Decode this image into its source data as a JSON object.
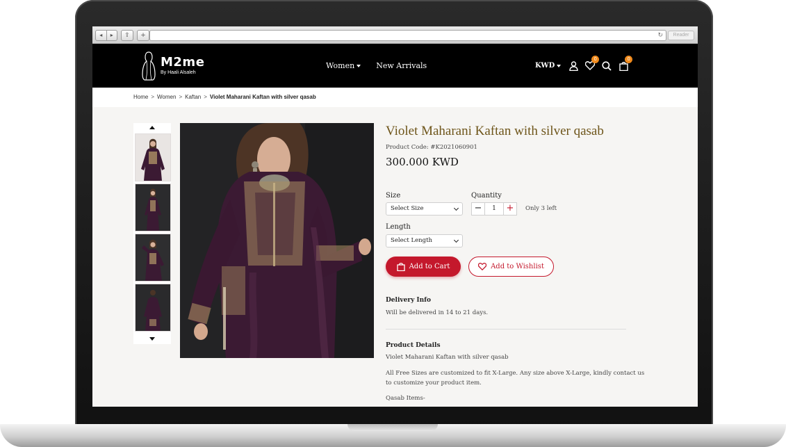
{
  "browser": {
    "reader_label": "Reader",
    "back_icon": "◂",
    "forward_icon": "▸",
    "share_icon": "⇪",
    "new_tab_icon": "+",
    "reload_icon": "↻"
  },
  "brand": {
    "name": "M2me",
    "tagline": "By Haali Alsaleh"
  },
  "nav": {
    "items": [
      {
        "label": "Women",
        "has_dropdown": true
      },
      {
        "label": "New Arrivals",
        "has_dropdown": false
      }
    ]
  },
  "header_tools": {
    "currency": "KWD",
    "wishlist_count": "0",
    "cart_count": "0"
  },
  "breadcrumb": {
    "items": [
      "Home",
      "Women",
      "Kaftan"
    ],
    "current": "Violet Maharani Kaftan with silver qasab",
    "separator": ">"
  },
  "product": {
    "title": "Violet Maharani Kaftan with silver qasab",
    "code_label": "Product Code:",
    "code": "#K2021060901",
    "price": "300.000 KWD",
    "size_label": "Size",
    "size_value": "Select Size",
    "quantity_label": "Quantity",
    "quantity": "1",
    "stock_note": "Only 3 left",
    "length_label": "Length",
    "length_value": "Select Length",
    "add_to_cart": "Add to Cart",
    "add_to_wishlist": "Add to Wishlist"
  },
  "delivery": {
    "heading": "Delivery Info",
    "text": "Will be delivered in 14 to 21 days."
  },
  "details": {
    "heading": "Product Details",
    "line1": "Violet Maharani Kaftan with silver qasab",
    "line2a": "All Free Sizes are customized to fit X-Large. Any size above X-Large, kindly contact us",
    "line2b": "to customize your product item.",
    "line3": "Qasab Items-"
  },
  "colors": {
    "accent": "#c4182c",
    "title_gold": "#6e551a",
    "badge": "#f08a1c",
    "header_bg": "#000000",
    "page_bg": "#f6f5f3",
    "garment": "#3b1a33"
  }
}
